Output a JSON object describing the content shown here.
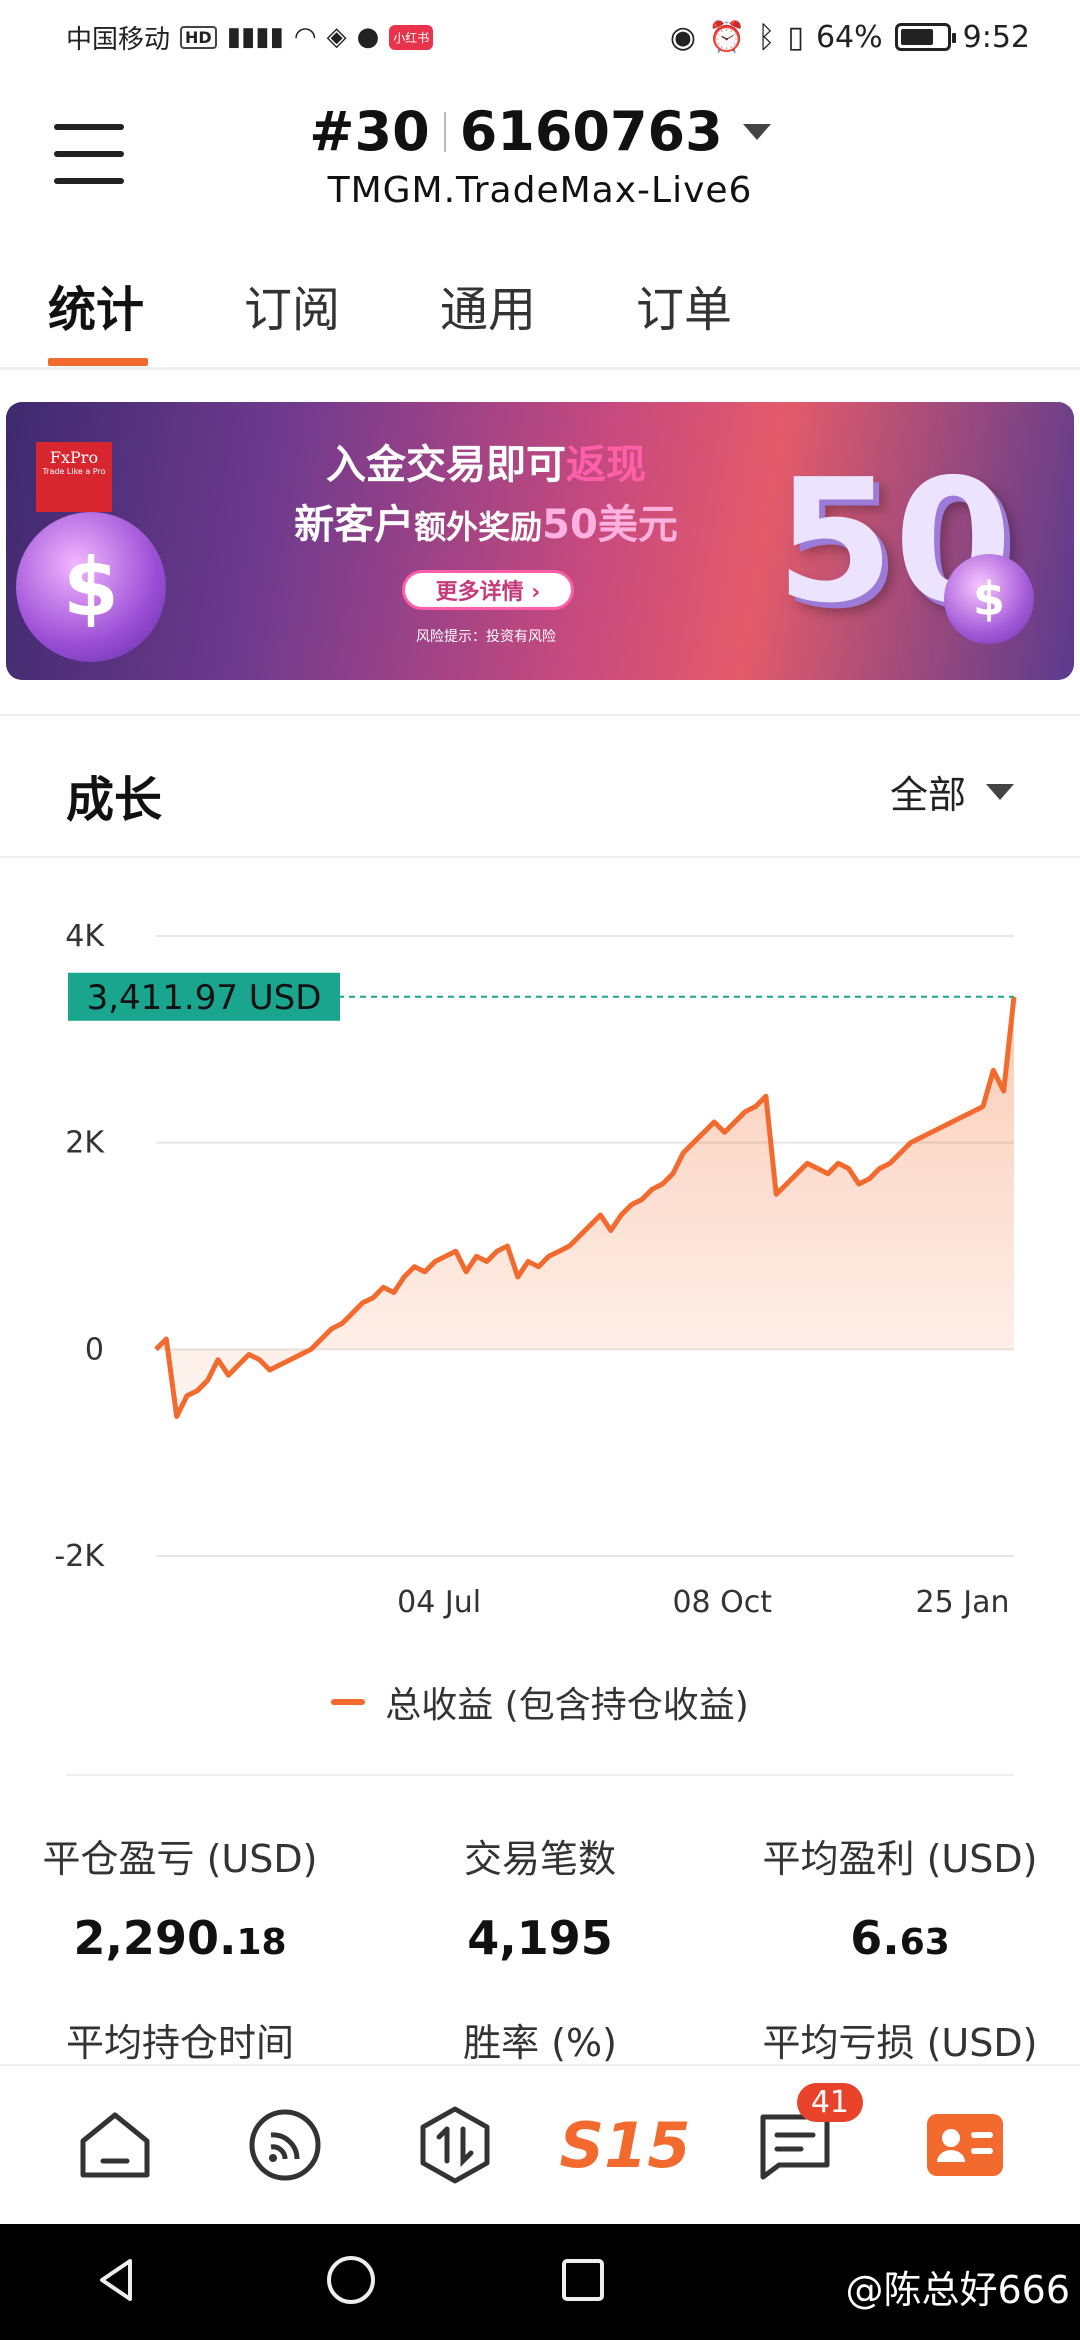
{
  "status_bar": {
    "carrier": "中国移动",
    "hd": "HD",
    "app_badge": "小红书",
    "battery": "64%",
    "time": "9:52"
  },
  "header": {
    "account_rank": "#30",
    "account_id": "6160763",
    "server": "TMGM.TradeMax-Live6"
  },
  "tabs": [
    {
      "label": "统计",
      "active": true
    },
    {
      "label": "订阅",
      "active": false
    },
    {
      "label": "通用",
      "active": false
    },
    {
      "label": "订单",
      "active": false
    }
  ],
  "banner": {
    "logo": "FxPro",
    "logo_tagline": "Trade Like a Pro",
    "line1_prefix": "入金交易即可",
    "line1_highlight": "返现",
    "line2_a": "新客户",
    "line2_b": "额外奖励",
    "line2_highlight": "50美元",
    "button": "更多详情",
    "risk": "风险提示：投资有风险",
    "big_number": "50",
    "coin_symbol": "$"
  },
  "growth": {
    "title": "成长",
    "range": "全部",
    "legend": "总收益 (包含持仓收益)",
    "current_label": "3,411.97 USD"
  },
  "chart_data": {
    "type": "area",
    "x_ticks": [
      "04 Jul",
      "08 Oct",
      "25 Jan"
    ],
    "y_ticks": [
      "4K",
      "2K",
      "0",
      "-2K"
    ],
    "ylim": [
      -2000,
      4000
    ],
    "current_value": 3411.97,
    "series": [
      {
        "name": "总收益 (包含持仓收益)",
        "color": "#f26a2d",
        "values": [
          0,
          100,
          -650,
          -450,
          -400,
          -300,
          -100,
          -250,
          -150,
          -50,
          -100,
          -200,
          -150,
          -100,
          -50,
          0,
          100,
          200,
          250,
          350,
          450,
          500,
          600,
          550,
          700,
          800,
          750,
          850,
          900,
          950,
          750,
          900,
          850,
          950,
          1000,
          700,
          850,
          800,
          900,
          950,
          1000,
          1100,
          1200,
          1300,
          1150,
          1300,
          1400,
          1450,
          1550,
          1600,
          1700,
          1900,
          2000,
          2100,
          2200,
          2100,
          2200,
          2300,
          2350,
          2450,
          1500,
          1600,
          1700,
          1800,
          1750,
          1700,
          1800,
          1750,
          1600,
          1650,
          1750,
          1800,
          1900,
          2000,
          2050,
          2100,
          2150,
          2200,
          2250,
          2300,
          2350,
          2700,
          2500,
          3411.97
        ]
      }
    ]
  },
  "stats": [
    {
      "label": "平仓盈亏 (USD)",
      "value_int": "2,290.",
      "value_dec": "18"
    },
    {
      "label": "交易笔数",
      "value_int": "4,195",
      "value_dec": ""
    },
    {
      "label": "平均盈利 (USD)",
      "value_int": "6.",
      "value_dec": "63"
    },
    {
      "label": "平均持仓时间"
    },
    {
      "label": "胜率 (%)"
    },
    {
      "label": "平均亏损 (USD)"
    }
  ],
  "bottom_nav": {
    "s15": "S15",
    "messages_badge": "41"
  },
  "watermark": "@陈总好666"
}
